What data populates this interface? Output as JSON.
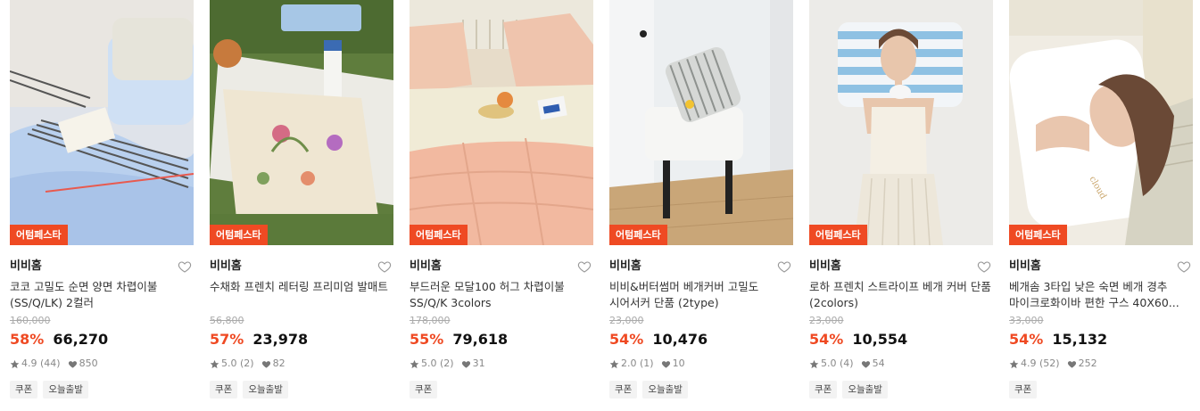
{
  "products": [
    {
      "badge": "어텀페스타",
      "brand": "비비홈",
      "title": "코코 고밀도 순면 양면 차렵이불 (SS/Q/LK) 2컬러",
      "original_price": "160,000",
      "discount": "58%",
      "price": "66,270",
      "rating": "4.9 (44)",
      "likes": "850",
      "tags": [
        "쿠폰",
        "오늘출발"
      ]
    },
    {
      "badge": "어텀페스타",
      "brand": "비비홈",
      "title": "수채화 프렌치 레터링 프리미엄 발매트",
      "original_price": "56,800",
      "discount": "57%",
      "price": "23,978",
      "rating": "5.0 (2)",
      "likes": "82",
      "tags": [
        "쿠폰",
        "오늘출발"
      ]
    },
    {
      "badge": "어텀페스타",
      "brand": "비비홈",
      "title": "부드러운 모달100 허그 차렵이불 SS/Q/K 3colors",
      "original_price": "178,000",
      "discount": "55%",
      "price": "79,618",
      "rating": "5.0 (2)",
      "likes": "31",
      "tags": [
        "쿠폰"
      ]
    },
    {
      "badge": "어텀페스타",
      "brand": "비비홈",
      "title": "비비&버터썸머 베개커버 고밀도 시어서커 단품 (2type)",
      "original_price": "23,000",
      "discount": "54%",
      "price": "10,476",
      "rating": "2.0 (1)",
      "likes": "10",
      "tags": [
        "쿠폰",
        "오늘출발"
      ]
    },
    {
      "badge": "어텀페스타",
      "brand": "비비홈",
      "title": "로하 프렌치 스트라이프 베개 커버 단품 (2colors)",
      "original_price": "23,000",
      "discount": "54%",
      "price": "10,554",
      "rating": "5.0 (4)",
      "likes": "54",
      "tags": [
        "쿠폰",
        "오늘출발"
      ]
    },
    {
      "badge": "어텀페스타",
      "brand": "비비홈",
      "title": "베개솜 3타입 낮은 숙면 베개 경추 마이크로화이바 편한 구스 40X60...",
      "original_price": "33,000",
      "discount": "54%",
      "price": "15,132",
      "rating": "4.9 (52)",
      "likes": "252",
      "tags": [
        "쿠폰"
      ]
    }
  ],
  "icons": {
    "heart": "heart-outline-icon",
    "star": "star-icon",
    "like": "heart-filled-icon"
  },
  "colors": {
    "accent": "#ef4a23",
    "badge_bg": "#ef4a23"
  }
}
